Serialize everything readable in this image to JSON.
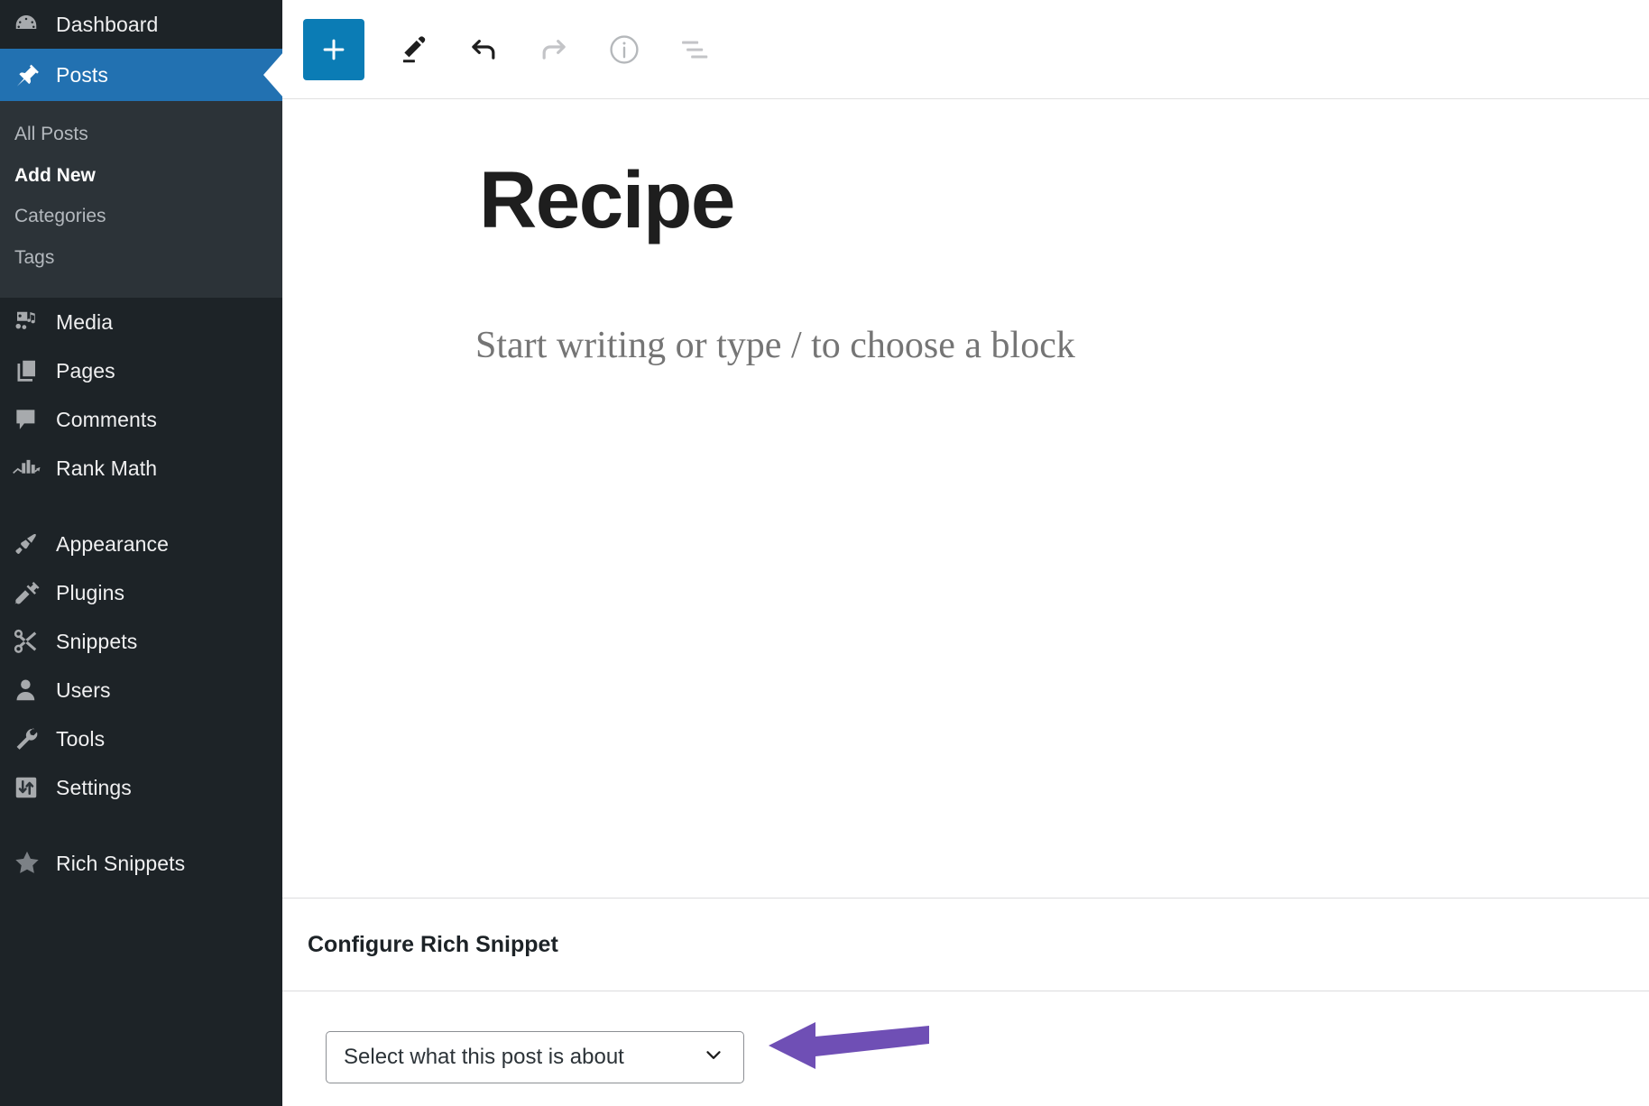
{
  "sidebar": {
    "items": [
      {
        "label": "Dashboard",
        "icon": "dashboard-gauge-icon",
        "name": "dashboard"
      },
      {
        "label": "Posts",
        "icon": "pin-icon",
        "name": "posts"
      },
      {
        "label": "Media",
        "icon": "media-icon",
        "name": "media"
      },
      {
        "label": "Pages",
        "icon": "pages-icon",
        "name": "pages"
      },
      {
        "label": "Comments",
        "icon": "comment-bubble-icon",
        "name": "comments"
      },
      {
        "label": "Rank Math",
        "icon": "rank-math-chart-icon",
        "name": "rank-math"
      },
      {
        "label": "Appearance",
        "icon": "paintbrush-icon",
        "name": "appearance"
      },
      {
        "label": "Plugins",
        "icon": "plug-icon",
        "name": "plugins"
      },
      {
        "label": "Snippets",
        "icon": "scissors-icon",
        "name": "snippets"
      },
      {
        "label": "Users",
        "icon": "user-icon",
        "name": "users"
      },
      {
        "label": "Tools",
        "icon": "wrench-icon",
        "name": "tools"
      },
      {
        "label": "Settings",
        "icon": "sliders-icon",
        "name": "settings"
      },
      {
        "label": "Rich Snippets",
        "icon": "star-icon",
        "name": "rich-snippets"
      }
    ],
    "current_item": "Posts",
    "submenu": [
      {
        "label": "All Posts",
        "active": false
      },
      {
        "label": "Add New",
        "active": true
      },
      {
        "label": "Categories",
        "active": false
      },
      {
        "label": "Tags",
        "active": false
      }
    ],
    "colors": {
      "background": "#1d2327",
      "submenu_background": "#2c3338",
      "current_highlight": "#2271b1",
      "label": "#f0f0f1",
      "muted_label": "#b4b9be"
    }
  },
  "toolbar": {
    "add_block_label": "+",
    "buttons": [
      {
        "name": "add-block-button",
        "icon": "plus-icon",
        "label": "Add block",
        "state": "enabled"
      },
      {
        "name": "tools-button",
        "icon": "pencil-icon",
        "label": "Tools",
        "state": "enabled"
      },
      {
        "name": "undo-button",
        "icon": "undo-arrow-icon",
        "label": "Undo",
        "state": "enabled"
      },
      {
        "name": "redo-button",
        "icon": "redo-arrow-icon",
        "label": "Redo",
        "state": "disabled"
      },
      {
        "name": "details-button",
        "icon": "info-circle-icon",
        "label": "Details",
        "state": "disabled"
      },
      {
        "name": "list-view-button",
        "icon": "list-view-icon",
        "label": "List View",
        "state": "disabled"
      }
    ],
    "accent_color": "#0b7cb5"
  },
  "editor": {
    "post_title": "Recipe",
    "block_placeholder": "Start writing or type / to choose a block"
  },
  "rich_snippet": {
    "heading": "Configure Rich Snippet",
    "select": {
      "value": "Select what this post is about",
      "icon": "chevron-down-icon"
    }
  },
  "annotation": {
    "arrow": {
      "name": "purple-pointer-arrow",
      "direction": "left",
      "color": "#6f4fb5"
    }
  }
}
